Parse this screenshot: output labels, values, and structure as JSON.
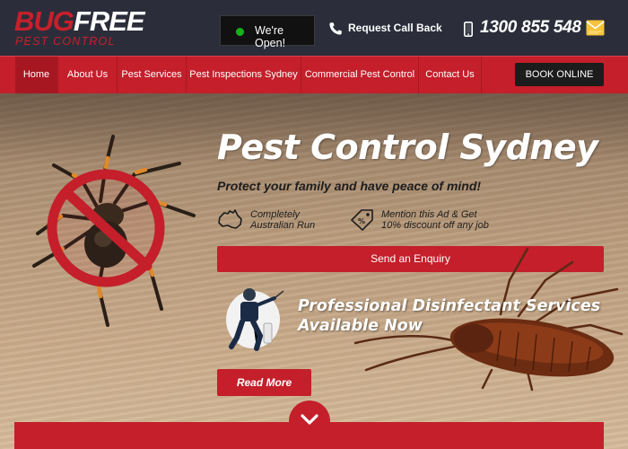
{
  "brand": {
    "name_part1": "BUG",
    "name_part2": "FREE",
    "tagline": "PEST CONTROL",
    "accent_color": "#c41f2b",
    "dark_color": "#2b2e3a"
  },
  "header": {
    "open_status": "We're Open!",
    "callback_label": "Request Call Back",
    "phone_number": "1300 855 548",
    "icons": [
      "status-dot-icon",
      "phone-icon",
      "mobile-phone-icon",
      "mail-icon"
    ]
  },
  "nav": {
    "items": [
      {
        "label": "Home",
        "active": true
      },
      {
        "label": "About Us",
        "active": false
      },
      {
        "label": "Pest Services",
        "active": false
      },
      {
        "label": "Pest Inspections Sydney",
        "active": false
      },
      {
        "label": "Commercial Pest Control",
        "active": false
      },
      {
        "label": "Contact Us",
        "active": false
      }
    ],
    "book_label": "BOOK ONLINE"
  },
  "hero": {
    "title": "Pest Control Sydney",
    "subtitle": "Protect your family and have peace of mind!",
    "features": [
      {
        "line1": "Completely",
        "line2": "Australian Run",
        "icon": "australia-map-icon"
      },
      {
        "line1": "Mention this Ad & Get",
        "line2": "10% discount off any job",
        "icon": "discount-tag-icon"
      }
    ],
    "enquiry_label": "Send an Enquiry",
    "promo_line1": "Professional Disinfectant Services",
    "promo_line2": "Available Now",
    "read_more_label": "Read More"
  }
}
